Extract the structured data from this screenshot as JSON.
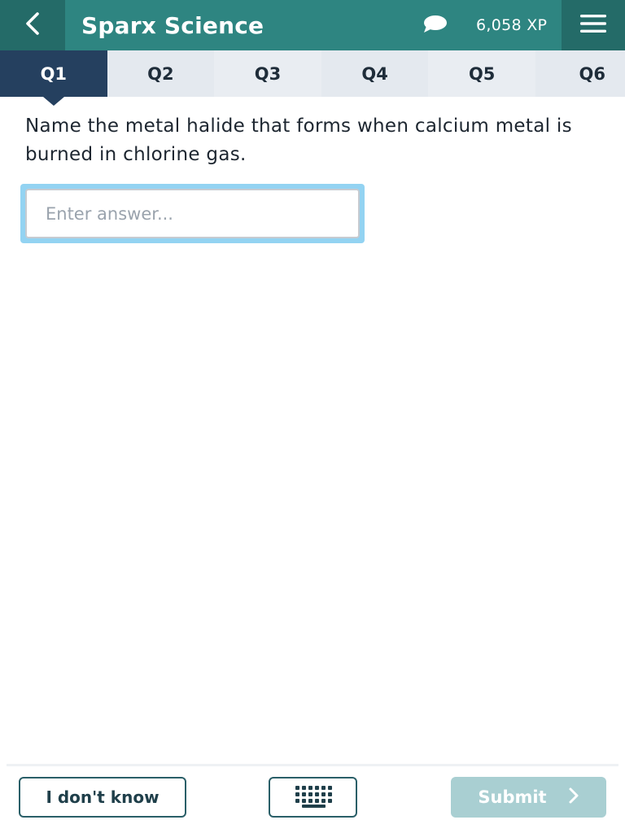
{
  "header": {
    "back_icon": "chevron-left-icon",
    "title": "Sparx Science",
    "chat_icon": "speech-bubble-icon",
    "xp": "6,058 XP",
    "menu_icon": "hamburger-menu-icon",
    "colors": {
      "bar": "#2e8581",
      "buttons": "#246b68"
    }
  },
  "tabs": [
    {
      "label": "Q1",
      "active": true
    },
    {
      "label": "Q2",
      "active": false
    },
    {
      "label": "Q3",
      "active": false
    },
    {
      "label": "Q4",
      "active": false
    },
    {
      "label": "Q5",
      "active": false
    },
    {
      "label": "Q6",
      "active": false
    }
  ],
  "question": {
    "text": "Name the metal halide that forms when calcium metal is burned in chlorine gas."
  },
  "answer": {
    "value": "",
    "placeholder": "Enter answer..."
  },
  "footer": {
    "dont_know_label": "I don't know",
    "keypad_icon": "keypad-icon",
    "submit_label": "Submit",
    "submit_icon": "chevron-right-icon",
    "submit_enabled": false
  }
}
